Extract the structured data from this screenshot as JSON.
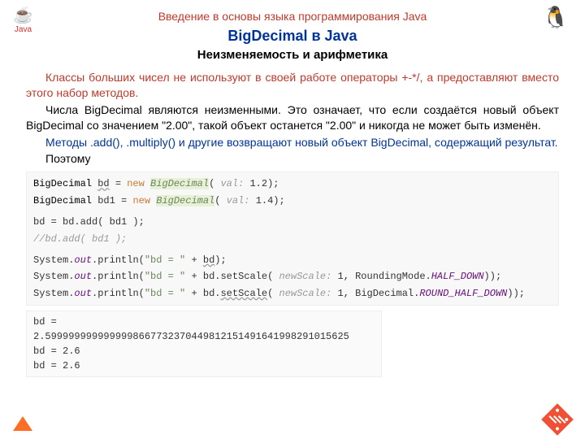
{
  "header": {
    "link": "Введение в основы языка программирования Java"
  },
  "title": "BigDecimal в Java",
  "subtitle": "Неизменяемость и арифметика",
  "para": {
    "p1a": "Классы больших чисел не используют в своей работе операторы +-*/, а предоставляют вместо этого набор методов.",
    "p2": "Числа BigDecimal являются неизменными. Это означает, что если создаётся новый объект BigDecimal со значением \"2.00\", такой объект останется \"2.00\" и никогда не может быть изменён.",
    "p3": "Методы .add(), .multiply() и другие возвращают новый объект BigDecimal, содержащий результат.",
    "p4": "Поэтому"
  },
  "code": {
    "l1": {
      "t": "BigDecimal ",
      "v": "bd",
      "eq": " = ",
      "kw": "new ",
      "cls": "BigDecimal",
      "op": "( ",
      "hint": "val: ",
      "val": "1.2",
      "cl": ");"
    },
    "l2": {
      "t": "BigDecimal ",
      "v": "bd1",
      "eq": " = ",
      "kw": "new ",
      "cls": "BigDecimal",
      "op": "( ",
      "hint": "val: ",
      "val": "1.4",
      "cl": ");"
    },
    "l3": "bd = bd.add( bd1 );",
    "l4": "//bd.add( bd1 );",
    "l5": {
      "a": "System.",
      "f": "out",
      "b": ".println(",
      "s": "\"bd = \"",
      "c": " + ",
      "v": "bd",
      "d": ");"
    },
    "l6": {
      "a": "System.",
      "f": "out",
      "b": ".println(",
      "s": "\"bd = \"",
      "c": " + bd.setScale( ",
      "hint": "newScale: ",
      "n": "1",
      "d": ", RoundingMode.",
      "e": "HALF_DOWN",
      "f2": "));"
    },
    "l7": {
      "a": "System.",
      "f": "out",
      "b": ".println(",
      "s": "\"bd = \"",
      "c": " + bd.",
      "warn": "setScale",
      "d": "( ",
      "hint": "newScale: ",
      "n": "1",
      "e": ", BigDecimal.",
      "g": "ROUND_HALF_DOWN",
      "f2": "));"
    }
  },
  "output": {
    "o1": "bd = 2.5999999999999998667732370449812151491641998291015625",
    "o2": "bd = 2.6",
    "o3": "bd = 2.6"
  },
  "icons": {
    "java": "Java",
    "java_cup": "☕",
    "duke": "🐧"
  }
}
